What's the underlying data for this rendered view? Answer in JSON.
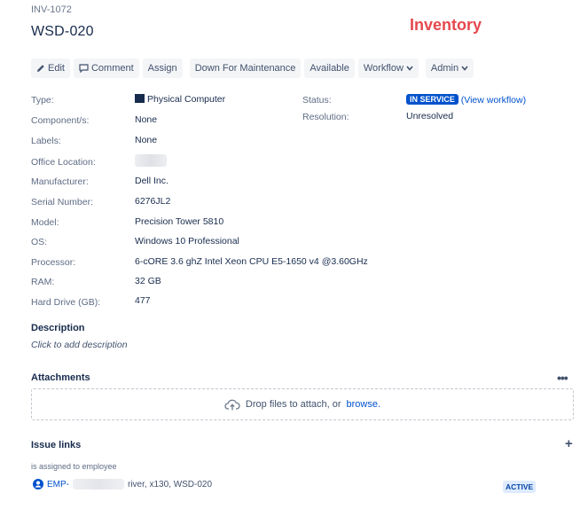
{
  "header": {
    "issue_key": "INV-1072",
    "title": "WSD-020",
    "brand": "Inventory"
  },
  "toolbar": {
    "edit": "Edit",
    "comment": "Comment",
    "assign": "Assign",
    "down_for_maintenance": "Down For Maintenance",
    "available": "Available",
    "workflow": "Workflow",
    "admin": "Admin"
  },
  "details": {
    "type_label": "Type:",
    "type_value": "Physical Computer",
    "components_label": "Component/s:",
    "components_value": "None",
    "labels_label": "Labels:",
    "labels_value": "None",
    "office_label": "Office Location:",
    "manufacturer_label": "Manufacturer:",
    "manufacturer_value": "Dell Inc.",
    "serial_label": "Serial Number:",
    "serial_value": "6276JL2",
    "model_label": "Model:",
    "model_value": "Precision Tower 5810",
    "os_label": "OS:",
    "os_value": "Windows 10 Professional",
    "processor_label": "Processor:",
    "processor_value": "6-cORE 3.6 ghZ Intel Xeon CPU E5-1650 v4 @3.60GHz",
    "ram_label": "RAM:",
    "ram_value": "32 GB",
    "hdd_label": "Hard Drive (GB):",
    "hdd_value": "477",
    "status_label": "Status:",
    "status_value": "IN SERVICE",
    "view_workflow": "(View workflow)",
    "resolution_label": "Resolution:",
    "resolution_value": "Unresolved"
  },
  "description": {
    "heading": "Description",
    "placeholder": "Click to add description"
  },
  "attachments": {
    "heading": "Attachments",
    "drop_text": "Drop files to attach, or",
    "browse": "browse."
  },
  "issue_links": {
    "heading": "Issue links",
    "link_type": "is assigned to employee",
    "link_prefix": "EMP-",
    "link_suffix": "river, x130, WSD-020",
    "link_status": "ACTIVE"
  },
  "colors": {
    "brand": "#e5484d",
    "status_blue": "#0052cc",
    "link_blue": "#0052cc"
  }
}
